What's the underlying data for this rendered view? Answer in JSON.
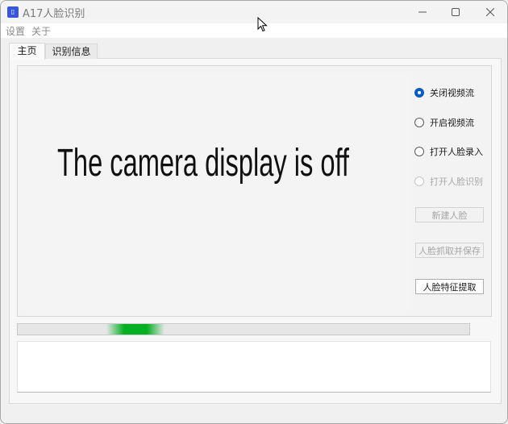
{
  "window": {
    "title": "A17人脸识别",
    "icon": "app-icon"
  },
  "menu": {
    "items": [
      "设置",
      "关于"
    ]
  },
  "tabs": [
    {
      "label": "主页",
      "active": true
    },
    {
      "label": "识别信息",
      "active": false
    }
  ],
  "camera": {
    "message": "The camera display is off"
  },
  "stream_options": [
    {
      "label": "关闭视频流",
      "checked": true,
      "enabled": true
    },
    {
      "label": "开启视频流",
      "checked": false,
      "enabled": true
    },
    {
      "label": "打开人脸录入",
      "checked": false,
      "enabled": true
    },
    {
      "label": "打开人脸识别",
      "checked": false,
      "enabled": false
    }
  ],
  "buttons": {
    "new_face": {
      "label": "新建人脸",
      "enabled": false
    },
    "capture_save": {
      "label": "人脸抓取并保存",
      "enabled": false
    },
    "extract_features": {
      "label": "人脸特征提取",
      "enabled": true
    }
  },
  "progress": {
    "style": "indeterminate",
    "accent_color": "#06b025"
  },
  "log": {
    "text": ""
  },
  "colors": {
    "radio_checked": "#0f5cc0",
    "app_icon": "#3a55d6"
  }
}
